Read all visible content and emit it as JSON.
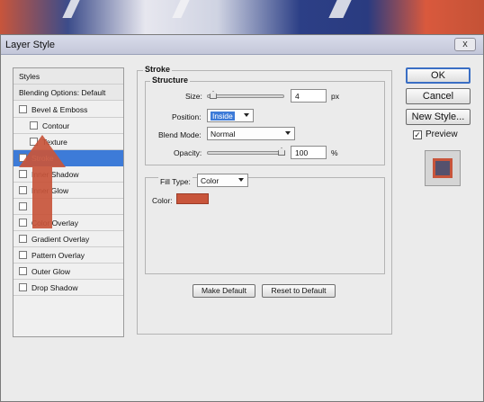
{
  "dialog": {
    "title": "Layer Style",
    "close_label": "x"
  },
  "styles_list": {
    "items": [
      {
        "label": "Styles",
        "checkbox": false,
        "checked": false,
        "indent": false,
        "selected": false,
        "header": true
      },
      {
        "label": "Blending Options: Default",
        "checkbox": false,
        "checked": false,
        "indent": false,
        "selected": false,
        "header": true
      },
      {
        "label": "Bevel & Emboss",
        "checkbox": true,
        "checked": false,
        "indent": false,
        "selected": false
      },
      {
        "label": "Contour",
        "checkbox": true,
        "checked": false,
        "indent": true,
        "selected": false
      },
      {
        "label": "Texture",
        "checkbox": true,
        "checked": false,
        "indent": true,
        "selected": false
      },
      {
        "label": "Stroke",
        "checkbox": true,
        "checked": true,
        "indent": false,
        "selected": true
      },
      {
        "label": "Inner Shadow",
        "checkbox": true,
        "checked": false,
        "indent": false,
        "selected": false
      },
      {
        "label": "Inner Glow",
        "checkbox": true,
        "checked": false,
        "indent": false,
        "selected": false
      },
      {
        "label": "",
        "checkbox": true,
        "checked": false,
        "indent": false,
        "selected": false
      },
      {
        "label": "Color Overlay",
        "checkbox": true,
        "checked": false,
        "indent": false,
        "selected": false
      },
      {
        "label": "Gradient Overlay",
        "checkbox": true,
        "checked": false,
        "indent": false,
        "selected": false
      },
      {
        "label": "Pattern Overlay",
        "checkbox": true,
        "checked": false,
        "indent": false,
        "selected": false
      },
      {
        "label": "Outer Glow",
        "checkbox": true,
        "checked": false,
        "indent": false,
        "selected": false
      },
      {
        "label": "Drop Shadow",
        "checkbox": true,
        "checked": false,
        "indent": false,
        "selected": false
      }
    ]
  },
  "stroke": {
    "section_title": "Stroke",
    "structure_title": "Structure",
    "size_label": "Size:",
    "size_value": "4",
    "size_unit": "px",
    "size_fraction": 0.02,
    "position_label": "Position:",
    "position_value": "Inside",
    "blend_mode_label": "Blend Mode:",
    "blend_mode_value": "Normal",
    "opacity_label": "Opacity:",
    "opacity_value": "100",
    "opacity_unit": "%",
    "opacity_fraction": 1.0,
    "fill_type_label": "Fill Type:",
    "fill_type_value": "Color",
    "color_label": "Color:",
    "stroke_color": "#c8553b"
  },
  "buttons": {
    "make_default": "Make Default",
    "reset_to_default": "Reset to Default",
    "ok": "OK",
    "cancel": "Cancel",
    "new_style": "New Style..."
  },
  "preview": {
    "label": "Preview",
    "checked": true
  }
}
